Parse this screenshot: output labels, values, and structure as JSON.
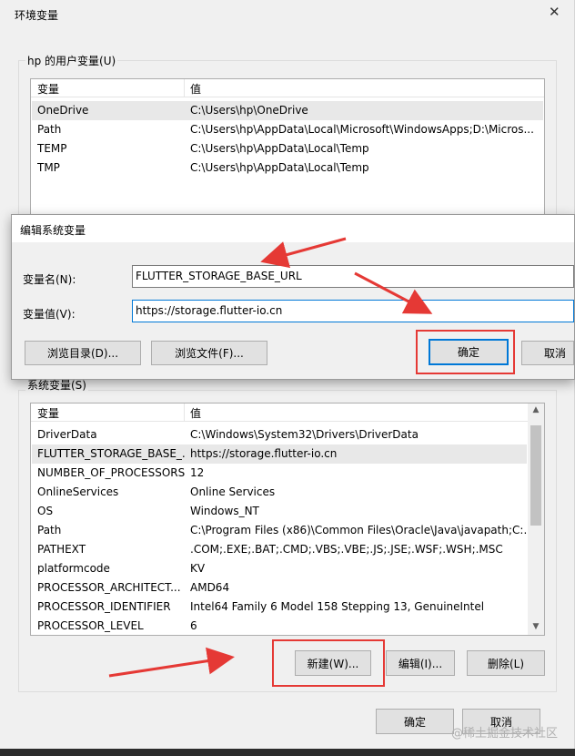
{
  "main_window": {
    "title": "环境变量",
    "user_section_label": "hp 的用户变量(U)",
    "user_table": {
      "headers": [
        "变量",
        "值"
      ],
      "rows": [
        {
          "name": "OneDrive",
          "value": "C:\\Users\\hp\\OneDrive"
        },
        {
          "name": "Path",
          "value": "C:\\Users\\hp\\AppData\\Local\\Microsoft\\WindowsApps;D:\\Micros..."
        },
        {
          "name": "TEMP",
          "value": "C:\\Users\\hp\\AppData\\Local\\Temp"
        },
        {
          "name": "TMP",
          "value": "C:\\Users\\hp\\AppData\\Local\\Temp"
        }
      ]
    },
    "system_section_label": "系统变量(S)",
    "system_table": {
      "headers": [
        "变量",
        "值"
      ],
      "rows": [
        {
          "name": "DriverData",
          "value": "C:\\Windows\\System32\\Drivers\\DriverData"
        },
        {
          "name": "FLUTTER_STORAGE_BASE_...",
          "value": "https://storage.flutter-io.cn"
        },
        {
          "name": "NUMBER_OF_PROCESSORS",
          "value": "12"
        },
        {
          "name": "OnlineServices",
          "value": "Online Services"
        },
        {
          "name": "OS",
          "value": "Windows_NT"
        },
        {
          "name": "Path",
          "value": "C:\\Program Files (x86)\\Common Files\\Oracle\\Java\\javapath;C:..."
        },
        {
          "name": "PATHEXT",
          "value": ".COM;.EXE;.BAT;.CMD;.VBS;.VBE;.JS;.JSE;.WSF;.WSH;.MSC"
        },
        {
          "name": "platformcode",
          "value": "KV"
        },
        {
          "name": "PROCESSOR_ARCHITECT...",
          "value": "AMD64"
        },
        {
          "name": "PROCESSOR_IDENTIFIER",
          "value": "Intel64 Family 6 Model 158 Stepping 13, GenuineIntel"
        },
        {
          "name": "PROCESSOR_LEVEL",
          "value": "6"
        }
      ]
    },
    "system_buttons": {
      "new": "新建(W)...",
      "edit": "编辑(I)...",
      "delete": "删除(L)"
    },
    "footer_buttons": {
      "ok": "确定",
      "cancel": "取消"
    }
  },
  "edit_dialog": {
    "title": "编辑系统变量",
    "name_label": "变量名(N):",
    "name_value": "FLUTTER_STORAGE_BASE_URL",
    "value_label": "变量值(V):",
    "value_value": "https://storage.flutter-io.cn",
    "browse_dir": "浏览目录(D)...",
    "browse_file": "浏览文件(F)...",
    "ok": "确定",
    "cancel": "取消"
  },
  "watermark": "@稀土掘金技术社区",
  "colors": {
    "annotation": "#e53935",
    "focus": "#0078d7"
  },
  "icons": {
    "close": "close-icon",
    "scroll_up": "scroll-up-icon",
    "scroll_down": "scroll-down-icon"
  }
}
